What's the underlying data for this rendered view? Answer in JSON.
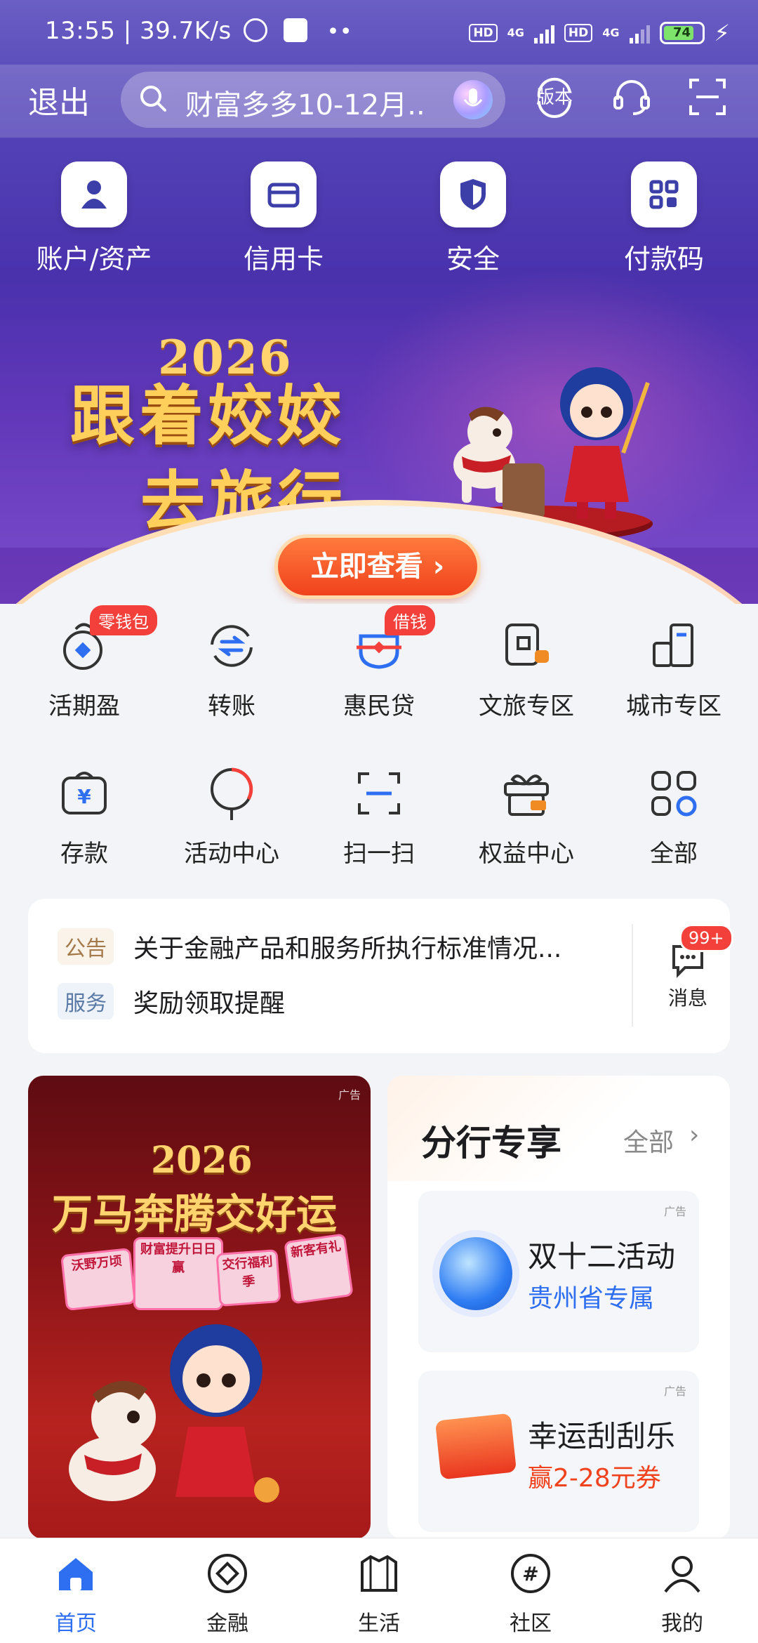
{
  "status_bar": {
    "time_speed": "13:55 | 39.7K/s",
    "hd1": "HD",
    "net1": "4G",
    "hd2": "HD",
    "net2": "4G",
    "battery": "74"
  },
  "top_bar": {
    "exit_label": "退出",
    "search_text": "财富多多10-12月...",
    "icons": [
      "version-icon",
      "customer-service-icon",
      "scan-frame-icon"
    ]
  },
  "quick_actions": [
    {
      "label": "账户/资产",
      "icon": "user-icon"
    },
    {
      "label": "信用卡",
      "icon": "credit-card-icon"
    },
    {
      "label": "安全",
      "icon": "shield-icon"
    },
    {
      "label": "付款码",
      "icon": "qr-code-icon"
    }
  ],
  "banner": {
    "year": "2026",
    "title_line1": "跟着姣姣",
    "title_line2": "去旅行",
    "cta": "立即查看 ›"
  },
  "services_row1": [
    {
      "label": "活期盈",
      "badge": "零钱包",
      "icon": "piggy-icon"
    },
    {
      "label": "转账",
      "badge": "",
      "icon": "transfer-icon"
    },
    {
      "label": "惠民贷",
      "badge": "借钱",
      "icon": "loan-icon"
    },
    {
      "label": "文旅专区",
      "badge": "",
      "icon": "travel-icon"
    },
    {
      "label": "城市专区",
      "badge": "",
      "icon": "city-icon"
    }
  ],
  "services_row2": [
    {
      "label": "存款",
      "icon": "deposit-icon"
    },
    {
      "label": "活动中心",
      "icon": "balloon-icon"
    },
    {
      "label": "扫一扫",
      "icon": "scan-icon"
    },
    {
      "label": "权益中心",
      "icon": "gift-icon"
    },
    {
      "label": "全部",
      "icon": "grid-icon"
    }
  ],
  "notices": [
    {
      "tag": "公告",
      "text": "关于金融产品和服务所执行标准情况..."
    },
    {
      "tag": "服务",
      "text": "奖励领取提醒"
    }
  ],
  "messages": {
    "badge": "99+",
    "label": "消息"
  },
  "promo_left": {
    "ad": "广告",
    "year": "2026",
    "title": "万马奔腾交好运",
    "tiles": [
      "沃野万顷",
      "财富提升日日赢",
      "交行福利季",
      "新客有礼"
    ]
  },
  "branch": {
    "title": "分行专享",
    "all": "全部",
    "items": [
      {
        "ad": "广告",
        "title": "双十二活动",
        "subtitle": "贵州省专属",
        "subtitle_color": "#2e6ef0"
      },
      {
        "ad": "广告",
        "title": "幸运刮刮乐",
        "subtitle": "赢2-28元券",
        "subtitle_color": "#f0421d"
      }
    ]
  },
  "tabs": [
    {
      "label": "首页",
      "active": true,
      "icon": "home-icon"
    },
    {
      "label": "金融",
      "active": false,
      "icon": "finance-icon"
    },
    {
      "label": "生活",
      "active": false,
      "icon": "life-icon"
    },
    {
      "label": "社区",
      "active": false,
      "icon": "community-icon"
    },
    {
      "label": "我的",
      "active": false,
      "icon": "profile-icon"
    }
  ],
  "colors": {
    "accent": "#2e6ef0",
    "hero": "#4a32ad",
    "badge": "#f4403a"
  }
}
